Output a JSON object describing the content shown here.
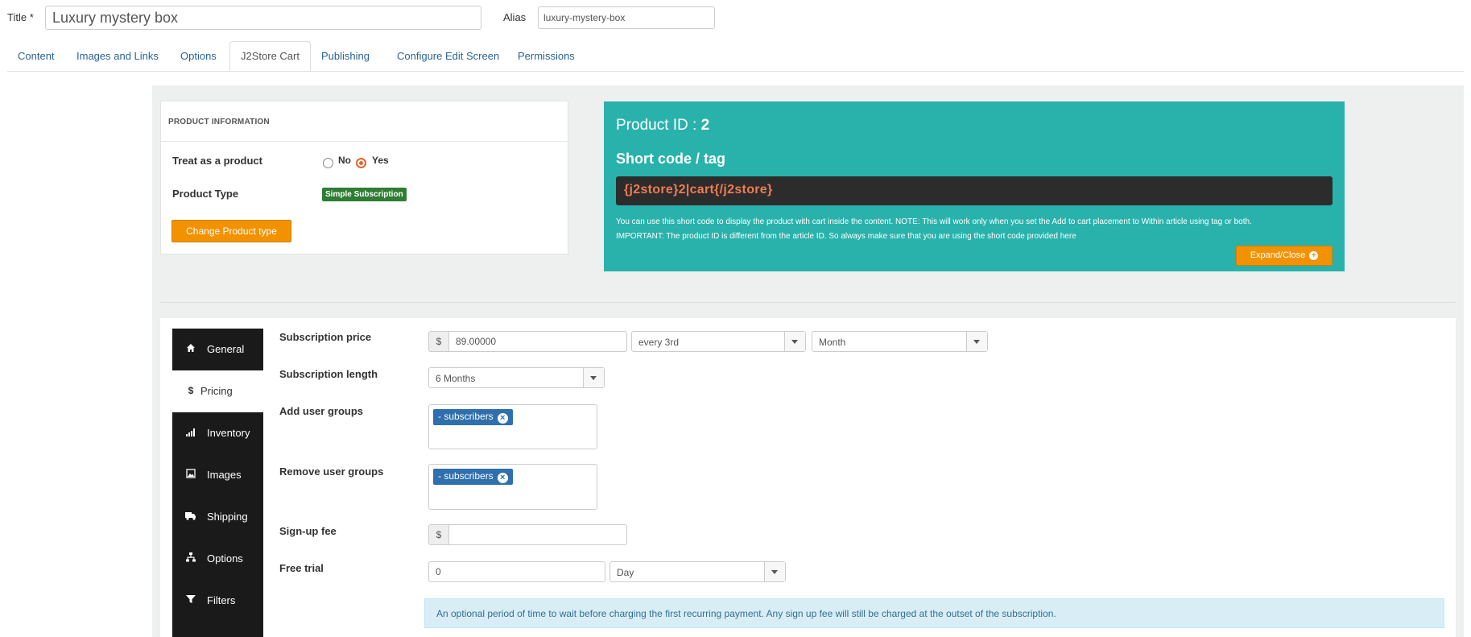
{
  "header": {
    "title_label": "Title *",
    "title_value": "Luxury mystery box",
    "alias_label": "Alias",
    "alias_value": "luxury-mystery-box"
  },
  "tabs": [
    {
      "label": "Content"
    },
    {
      "label": "Images and Links"
    },
    {
      "label": "Options"
    },
    {
      "label": "J2Store Cart",
      "active": true
    },
    {
      "label": "Publishing"
    },
    {
      "label": "Configure Edit Screen"
    },
    {
      "label": "Permissions"
    }
  ],
  "product_info": {
    "heading": "PRODUCT INFORMATION",
    "treat_label": "Treat as a product",
    "no_label": "No",
    "yes_label": "Yes",
    "treat_selected": "Yes",
    "type_label": "Product Type",
    "type_badge": "Simple Subscription",
    "change_button": "Change Product type"
  },
  "shortcode_panel": {
    "product_id_label": "Product ID :",
    "product_id": "2",
    "short_code_heading": "Short code / tag",
    "code": "{j2store}2|cart{/j2store}",
    "note1": "You can use this short code to display the product with cart inside the content. NOTE: This will work only when you set the Add to cart placement to Within article using tag or both.",
    "note2": "IMPORTANT: The product ID is different from the article ID. So always make sure that you are using the short code provided here",
    "expand_button": "Expand/Close"
  },
  "sidenav": [
    {
      "label": "General",
      "icon": "home-icon"
    },
    {
      "label": "Pricing",
      "icon": "dollar-icon",
      "active": true
    },
    {
      "label": "Inventory",
      "icon": "signal-icon"
    },
    {
      "label": "Images",
      "icon": "image-icon"
    },
    {
      "label": "Shipping",
      "icon": "truck-icon"
    },
    {
      "label": "Options",
      "icon": "sitemap-icon"
    },
    {
      "label": "Filters",
      "icon": "filter-icon"
    }
  ],
  "pricing": {
    "subscription_price_label": "Subscription price",
    "currency": "$",
    "price_value": "89.00000",
    "interval_value": "every 3rd",
    "period_value": "Month",
    "subscription_length_label": "Subscription length",
    "length_value": "6 Months",
    "add_groups_label": "Add user groups",
    "add_groups_tag": "- subscribers",
    "remove_groups_label": "Remove user groups",
    "remove_groups_tag": "- subscribers",
    "signup_fee_label": "Sign-up fee",
    "signup_fee_value": "",
    "free_trial_label": "Free trial",
    "free_trial_value": "0",
    "free_trial_period": "Day",
    "info_text": "An optional period of time to wait before charging the first recurring payment. Any sign up fee will still be charged at the outset of the subscription."
  },
  "colors": {
    "teal": "#29b2ab",
    "orange": "#f39200",
    "green_badge": "#2e7d32",
    "tag_blue": "#2f6fad",
    "code_text": "#f07b52"
  }
}
